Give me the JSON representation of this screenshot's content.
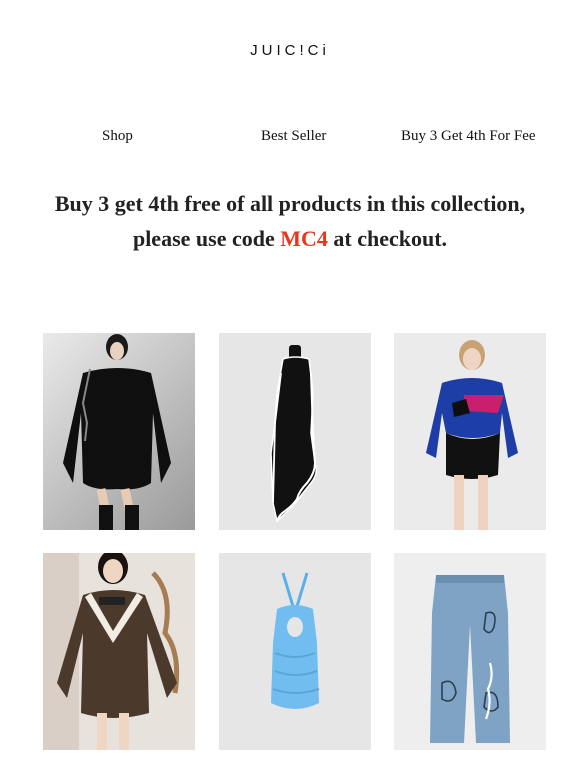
{
  "brand": {
    "logo_text": "JUIC!Ci"
  },
  "nav": [
    {
      "label": "Shop"
    },
    {
      "label": "Best Seller"
    },
    {
      "label": "Buy 3 Get 4th For Fee"
    }
  ],
  "promo": {
    "line1": "Buy 3 get 4th free of all products in this collection,",
    "line2_before": "please use code ",
    "code": "MC4",
    "line2_after": " at checkout.",
    "code_color": "#e8361b"
  },
  "products": [
    {
      "icon": "black-sweatshirt-dress-image"
    },
    {
      "icon": "black-asymmetric-dress-image"
    },
    {
      "icon": "blue-cropped-sweater-image"
    },
    {
      "icon": "brown-v-neck-dress-image"
    },
    {
      "icon": "blue-halter-dress-image"
    },
    {
      "icon": "printed-jeans-image"
    }
  ]
}
